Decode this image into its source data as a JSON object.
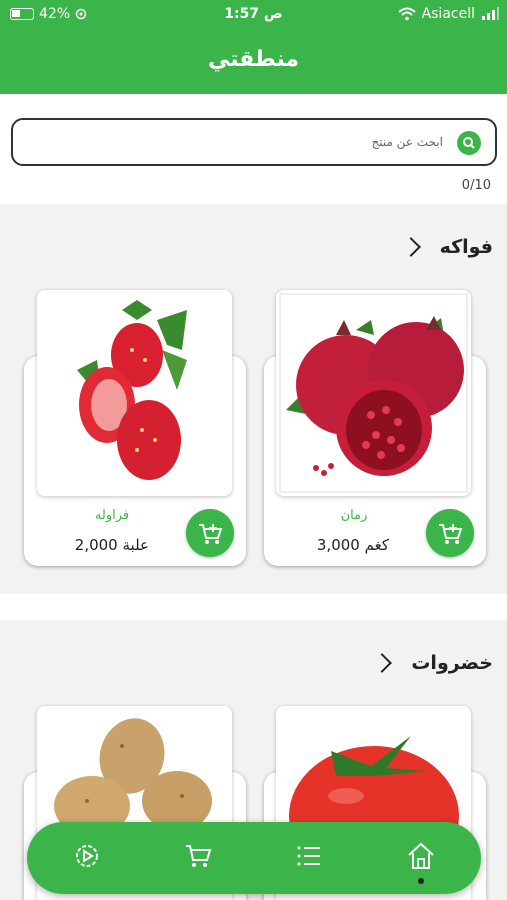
{
  "status": {
    "battery": "42%",
    "time": "1:57",
    "ampm": "ص",
    "carrier": "Asiacell"
  },
  "header": {
    "title": "منطقتي"
  },
  "search": {
    "placeholder": "ابحث عن منتج",
    "counter": "0/10"
  },
  "sections": [
    {
      "title": "فواكه",
      "products": [
        {
          "name": "رمان",
          "price": "3,000",
          "unit": "كغم",
          "image": "pomegranate"
        },
        {
          "name": "فراوله",
          "price": "2,000",
          "unit": "علبة",
          "image": "strawberry"
        }
      ]
    },
    {
      "title": "خضروات",
      "products": [
        {
          "image": "tomato"
        },
        {
          "image": "potato"
        }
      ]
    }
  ],
  "nav": {
    "items": [
      "home-icon",
      "list-icon",
      "cart-icon",
      "settings-icon"
    ],
    "active": "home"
  },
  "colors": {
    "primary": "#3bb54a",
    "background": "#f2f2f2"
  }
}
